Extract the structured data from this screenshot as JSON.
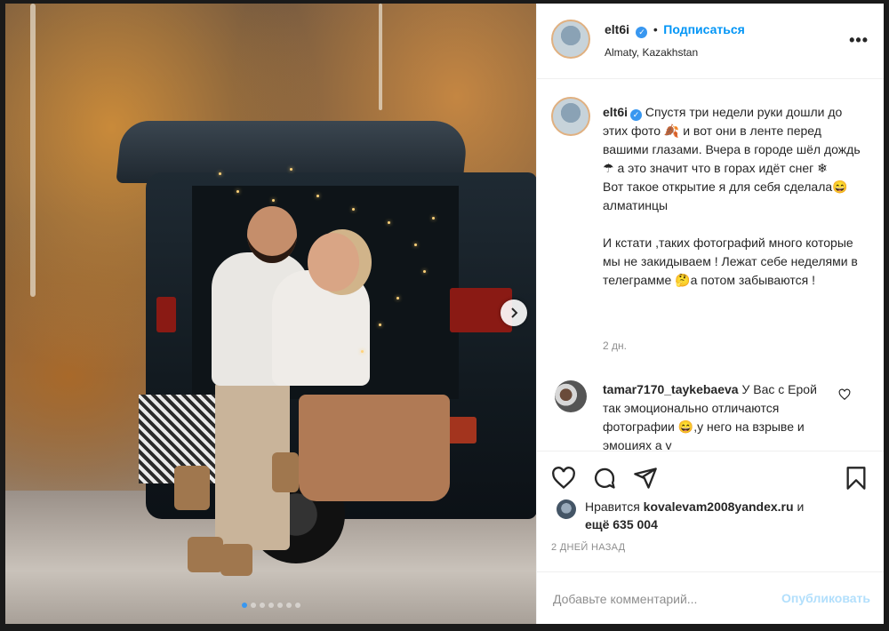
{
  "post": {
    "username": "elt6i",
    "follow_label": "Подписаться",
    "location": "Almaty, Kazakhstan",
    "more_glyph": "•••",
    "verified_glyph": "✓",
    "carousel_count": 7,
    "carousel_active": 0
  },
  "caption": {
    "username": "elt6i",
    "text": "Спустя три недели руки дошли до этих фото 🍂 и вот они в ленте перед вашими глазами. Вчера в городе шёл дождь ☂ а это значит что в горах идёт снег ❄\nВот такое открытие я для себя сделала😄алматинцы\n\nИ кстати ,таких фотографий много которые мы не закидываем ! Лежат себе неделями в телеграмме 🤔а потом забываются !",
    "time": "2 дн."
  },
  "comment": {
    "username": "tamar7170_taykebaeva",
    "text": "У Вас с Ерой так эмоционально отличаются фотографии 😄,у него на взрыве и эмоциях а у"
  },
  "likes": {
    "prefix": "Нравится",
    "liker": "kovalevam2008yandex.ru",
    "conj": "и",
    "others": "ещё 635 004"
  },
  "posted_ago": "2 ДНЕЙ НАЗАД",
  "add_comment": {
    "placeholder": "Добавьте комментарий...",
    "publish_label": "Опубликовать"
  },
  "colors": {
    "accent": "#0095f6",
    "verified": "#3897f0",
    "muted": "#8e8e8e"
  }
}
